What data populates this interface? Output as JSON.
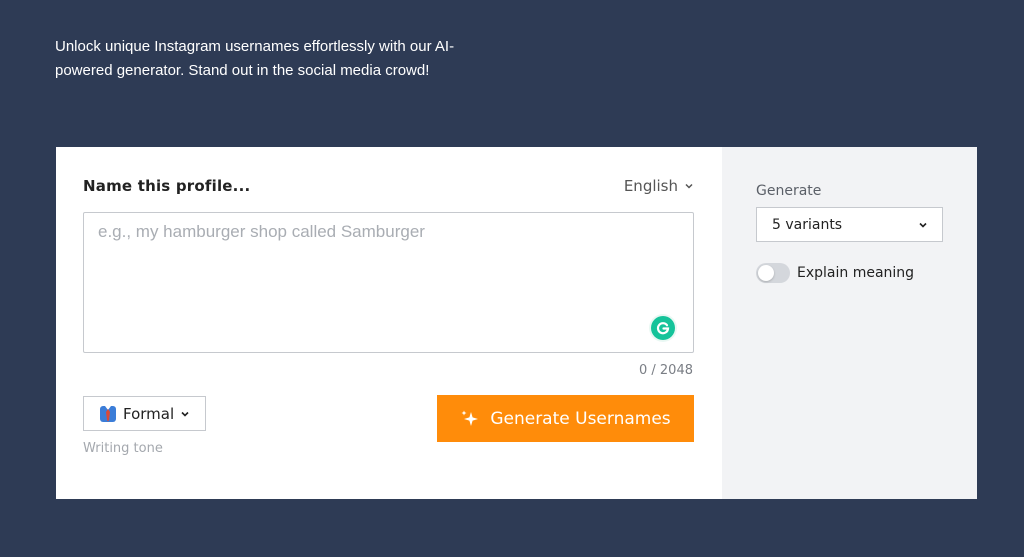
{
  "intro": {
    "text": "Unlock unique Instagram usernames effortlessly with our AI-powered generator. Stand out in the social media crowd!"
  },
  "form": {
    "profile_label": "Name this profile...",
    "language": "English",
    "language_icon": "chevron-down-icon",
    "input_value": "",
    "input_placeholder": "e.g., my hamburger shop called Samburger",
    "grammarly_icon": "grammarly-icon",
    "char_count": "0 / 2048",
    "tone": {
      "value": "Formal",
      "icon": "necktie-icon",
      "caption": "Writing tone"
    },
    "generate_button": {
      "label": "Generate Usernames",
      "icon": "sparkle-icon",
      "color": "#ff8c0a"
    }
  },
  "options": {
    "generate_label": "Generate",
    "variants_value": "5 variants",
    "explain_label": "Explain meaning",
    "explain_enabled": false
  },
  "colors": {
    "background": "#2e3b55",
    "panel": "#ffffff",
    "side_panel": "#f2f3f5",
    "accent": "#ff8c0a"
  }
}
